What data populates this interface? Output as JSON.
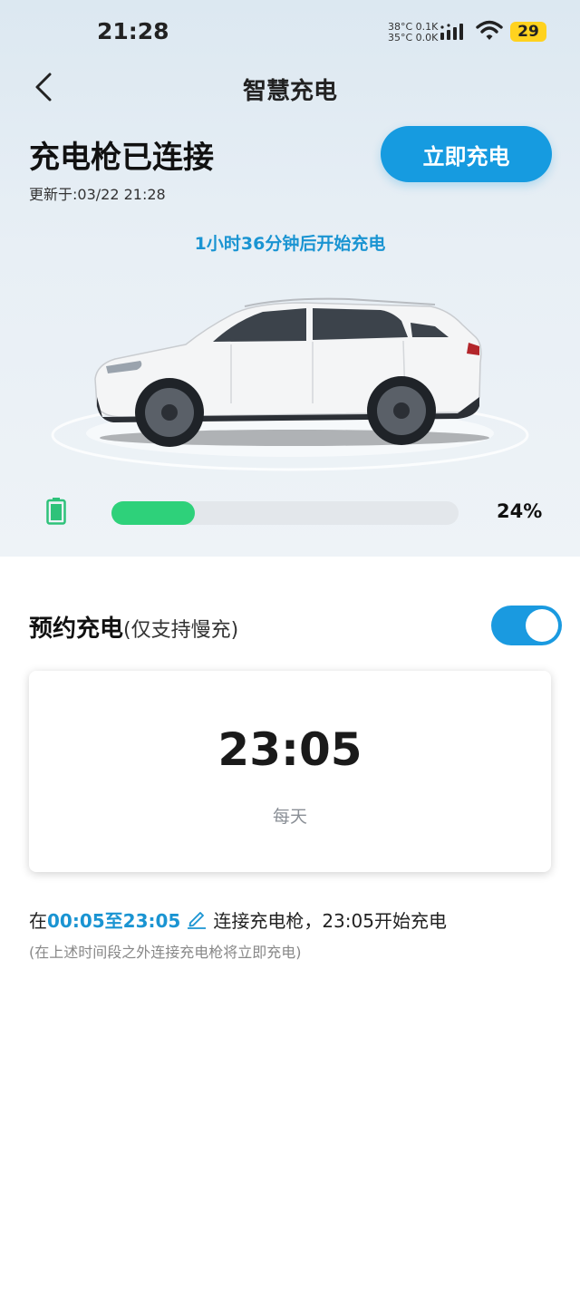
{
  "status_bar": {
    "time": "21:28",
    "net_line1": "38°C 0.1K",
    "net_line2": "35°C 0.0K",
    "battery": "29",
    "battery_color": "#ffd21f"
  },
  "nav": {
    "title": "智慧充电",
    "back_icon": "chevron-left-icon"
  },
  "status": {
    "title": "充电枪已连接",
    "updated": "更新于:03/22 21:28",
    "charge_now_label": "立即充电",
    "countdown": "1小时36分钟后开始充电"
  },
  "battery": {
    "percent_label": "24%",
    "level": 0.24,
    "fill_color": "#2ed17a"
  },
  "schedule": {
    "title": "预约充电",
    "note": "(仅支持慢充)",
    "enabled": true,
    "time": "23:05",
    "repeat": "每天",
    "window_prefix": "在",
    "window_range": "00:05至23:05",
    "window_suffix": "连接充电枪，23:05开始充电",
    "hint": "(在上述时间段之外连接充电枪将立即充电)"
  },
  "colors": {
    "accent": "#169be0",
    "link": "#1a94d2"
  }
}
